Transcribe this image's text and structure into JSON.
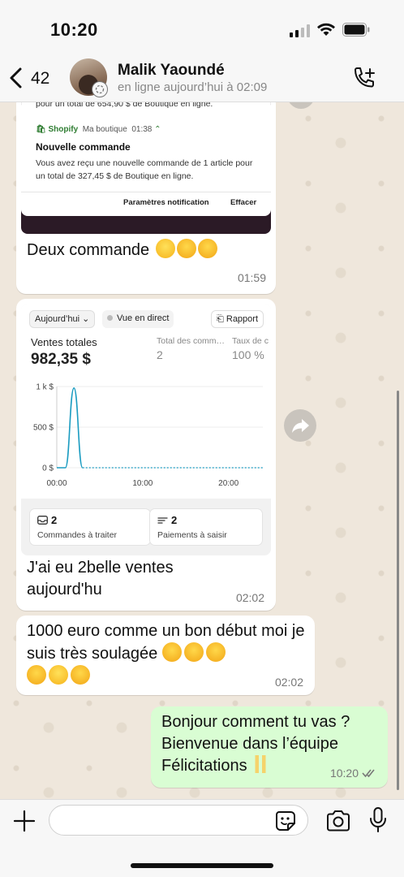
{
  "status_bar": {
    "time": "10:20"
  },
  "header": {
    "back_count": "42",
    "contact_name": "Malik Yaoundé",
    "contact_status": "en ligne aujourd’hui à 02:09"
  },
  "messages": {
    "m1": {
      "screenshot": {
        "top_line": "pour un total de 654,90 $ de Boutique en ligne.",
        "app": "Shopify",
        "shop": "Ma boutique",
        "time": "01:38",
        "title": "Nouvelle commande",
        "body": "Vous avez reçu une nouvelle commande de 1 article pour un total de 327,45 $ de Boutique en ligne.",
        "action_settings": "Paramètres notification",
        "action_clear": "Effacer"
      },
      "text": "Deux commande",
      "emojis": [
        "smiling-face-emoji",
        "partying-face-emoji",
        "partying-face-emoji"
      ],
      "time": "01:59"
    },
    "m2": {
      "screenshot": {
        "filter_today": "Aujourd’hui",
        "filter_live": "Vue en direct",
        "report_button": "Rapport",
        "kpi_label": "Ventes totales",
        "kpi_value": "982,35 $",
        "kpi2_label": "Total des comm…",
        "kpi2_value": "2",
        "kpi3_label": "Taux de c",
        "kpi3_value": "100 %",
        "card1_value": "2",
        "card1_label": "Commandes à traiter",
        "card2_value": "2",
        "card2_label": "Paiements à saisir"
      },
      "text": "J'ai eu 2belle ventes aujourd'hu",
      "time": "02:02"
    },
    "m3": {
      "text": "1000 euro comme un bon début moi je suis très soulagée",
      "emojis": [
        "partying-face-emoji",
        "partying-face-emoji",
        "partying-face-emoji",
        "partying-face-emoji",
        "smiling-face-emoji",
        "partying-face-emoji"
      ],
      "time": "02:02"
    },
    "m4": {
      "line1": "Bonjour comment tu vas ?",
      "line2": "Bienvenue dans l’équipe",
      "line3": "Félicitations",
      "time": "10:20"
    }
  },
  "input": {
    "value": ""
  },
  "colors": {
    "sent_bubble": "#d9fdd3",
    "received_bubble": "#ffffff",
    "chat_bg": "#efe7dc",
    "chart_line": "#1b9cc1",
    "shopify_green": "#2f7d32"
  },
  "chart_data": {
    "type": "line",
    "x": [
      "00:00",
      "01:00",
      "02:00",
      "03:00",
      "04:00",
      "05:00",
      "06:00",
      "08:00",
      "10:00",
      "12:00",
      "14:00",
      "16:00",
      "18:00",
      "20:00",
      "22:00",
      "24:00"
    ],
    "series": [
      {
        "values": [
          0,
          0,
          982,
          0,
          0,
          0,
          0,
          0,
          0,
          0,
          0,
          0,
          0,
          0,
          0,
          0
        ]
      }
    ],
    "xticks": [
      "00:00",
      "10:00",
      "20:00"
    ],
    "yticks": [
      "0 $",
      "500 $",
      "1 k $"
    ],
    "ylim": [
      0,
      1000
    ]
  }
}
